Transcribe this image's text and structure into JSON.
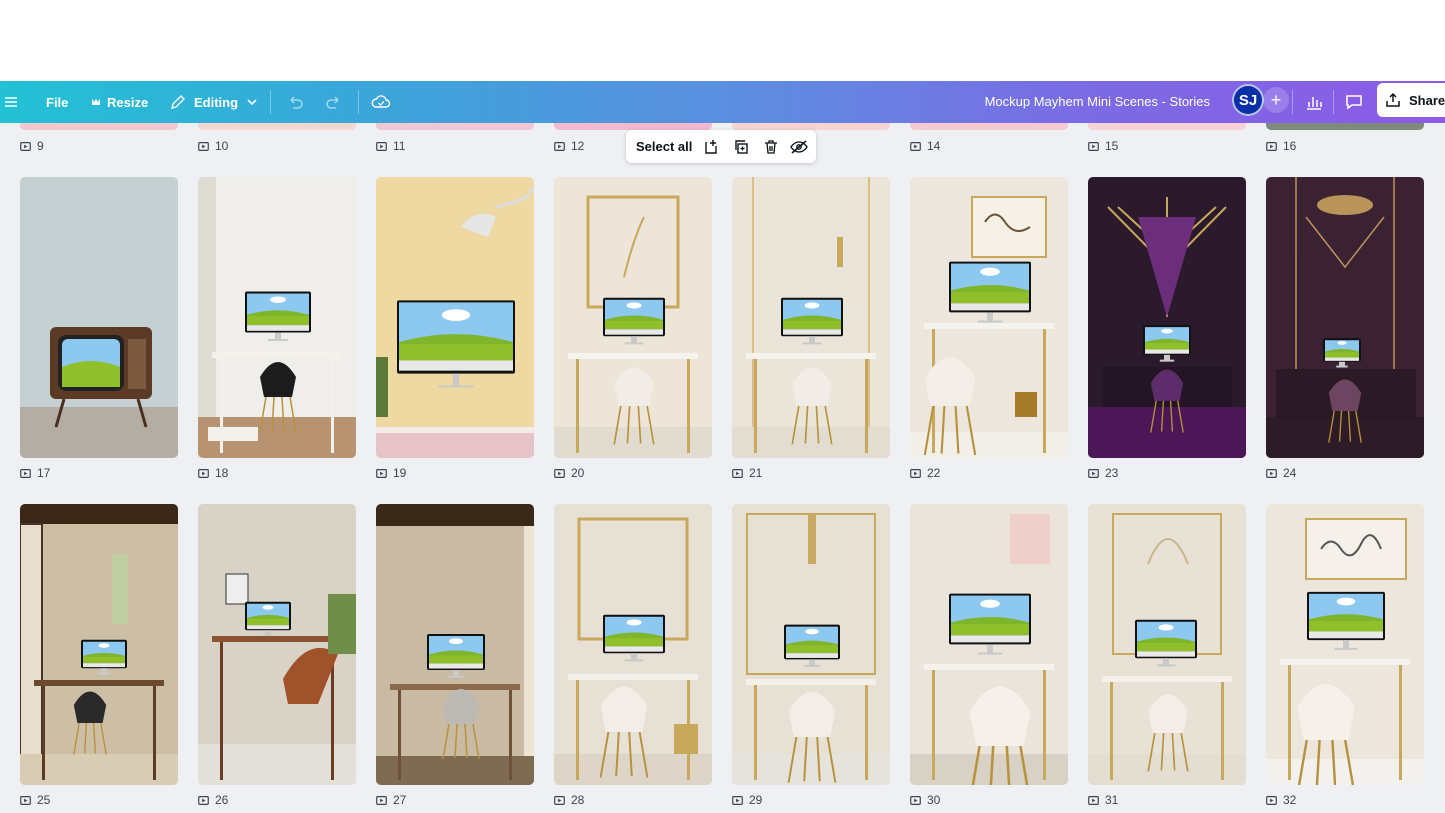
{
  "toolbar": {
    "file_label": "File",
    "resize_label": "Resize",
    "editing_label": "Editing",
    "title": "Mockup Mayhem Mini Scenes - Stories",
    "avatar_initials": "SJ",
    "share_label": "Share"
  },
  "selection": {
    "select_all_label": "Select all"
  },
  "top_row_captions": [
    "9",
    "10",
    "11",
    "12",
    "14",
    "15",
    "16"
  ],
  "pages": [
    {
      "number": "17",
      "scene": "retro-tv"
    },
    {
      "number": "18",
      "scene": "white-bookshelf-desk"
    },
    {
      "number": "19",
      "scene": "yellow-wall-monitor"
    },
    {
      "number": "20",
      "scene": "gold-frame-desk"
    },
    {
      "number": "21",
      "scene": "gold-sconce-desk"
    },
    {
      "number": "22",
      "scene": "gold-lamp-desk"
    },
    {
      "number": "23",
      "scene": "art-deco-purple"
    },
    {
      "number": "24",
      "scene": "art-deco-plum"
    },
    {
      "number": "25",
      "scene": "japanese-room"
    },
    {
      "number": "26",
      "scene": "wood-desk-leather-chair"
    },
    {
      "number": "27",
      "scene": "minimal-japanese"
    },
    {
      "number": "28",
      "scene": "gold-frame-white-chair"
    },
    {
      "number": "29",
      "scene": "sconce-white-chair"
    },
    {
      "number": "30",
      "scene": "large-white-chair"
    },
    {
      "number": "31",
      "scene": "palm-art-desk"
    },
    {
      "number": "32",
      "scene": "script-art-desk"
    }
  ],
  "colors": {
    "toolbar_start": "#22c1d4",
    "toolbar_end": "#8c5ae6",
    "avatar_bg": "#0b2fa8",
    "canvas_bg": "#eef0f4"
  }
}
